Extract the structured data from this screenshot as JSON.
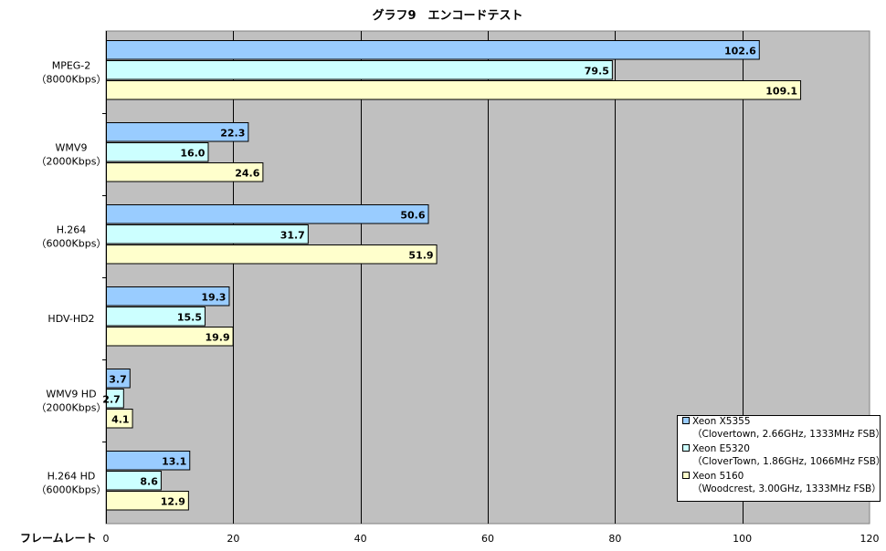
{
  "chart_data": {
    "type": "bar",
    "orientation": "horizontal",
    "title": "グラフ9　エンコードテスト",
    "xlabel": "フレームレート",
    "xlim": [
      0,
      120
    ],
    "xticks": [
      0,
      20,
      40,
      60,
      80,
      100,
      120
    ],
    "grid": true,
    "legend_position": "bottom-right",
    "categories": [
      [
        "MPEG-2",
        "（8000Kbps）"
      ],
      [
        "WMV9",
        "（2000Kbps）"
      ],
      [
        "H.264",
        "（6000Kbps）"
      ],
      [
        "HDV-HD2"
      ],
      [
        "WMV9 HD",
        "（2000Kbps）"
      ],
      [
        "H.264 HD",
        "（6000Kbps）"
      ]
    ],
    "series": [
      {
        "name": [
          "Xeon X5355",
          "（Clovertown, 2.66GHz, 1333MHz FSB）"
        ],
        "color": "#99ccff",
        "values": [
          102.6,
          22.3,
          50.6,
          19.3,
          3.7,
          13.1
        ]
      },
      {
        "name": [
          "Xeon E5320",
          "（CloverTown, 1.86GHz, 1066MHz FSB）"
        ],
        "color": "#ccffff",
        "values": [
          79.5,
          16.0,
          31.7,
          15.5,
          2.7,
          8.6
        ]
      },
      {
        "name": [
          "Xeon 5160",
          "（Woodcrest, 3.00GHz, 1333MHz FSB）"
        ],
        "color": "#ffffcc",
        "values": [
          109.1,
          24.6,
          51.9,
          19.9,
          4.1,
          12.9
        ]
      }
    ],
    "plot_background": "#c0c0c0"
  }
}
